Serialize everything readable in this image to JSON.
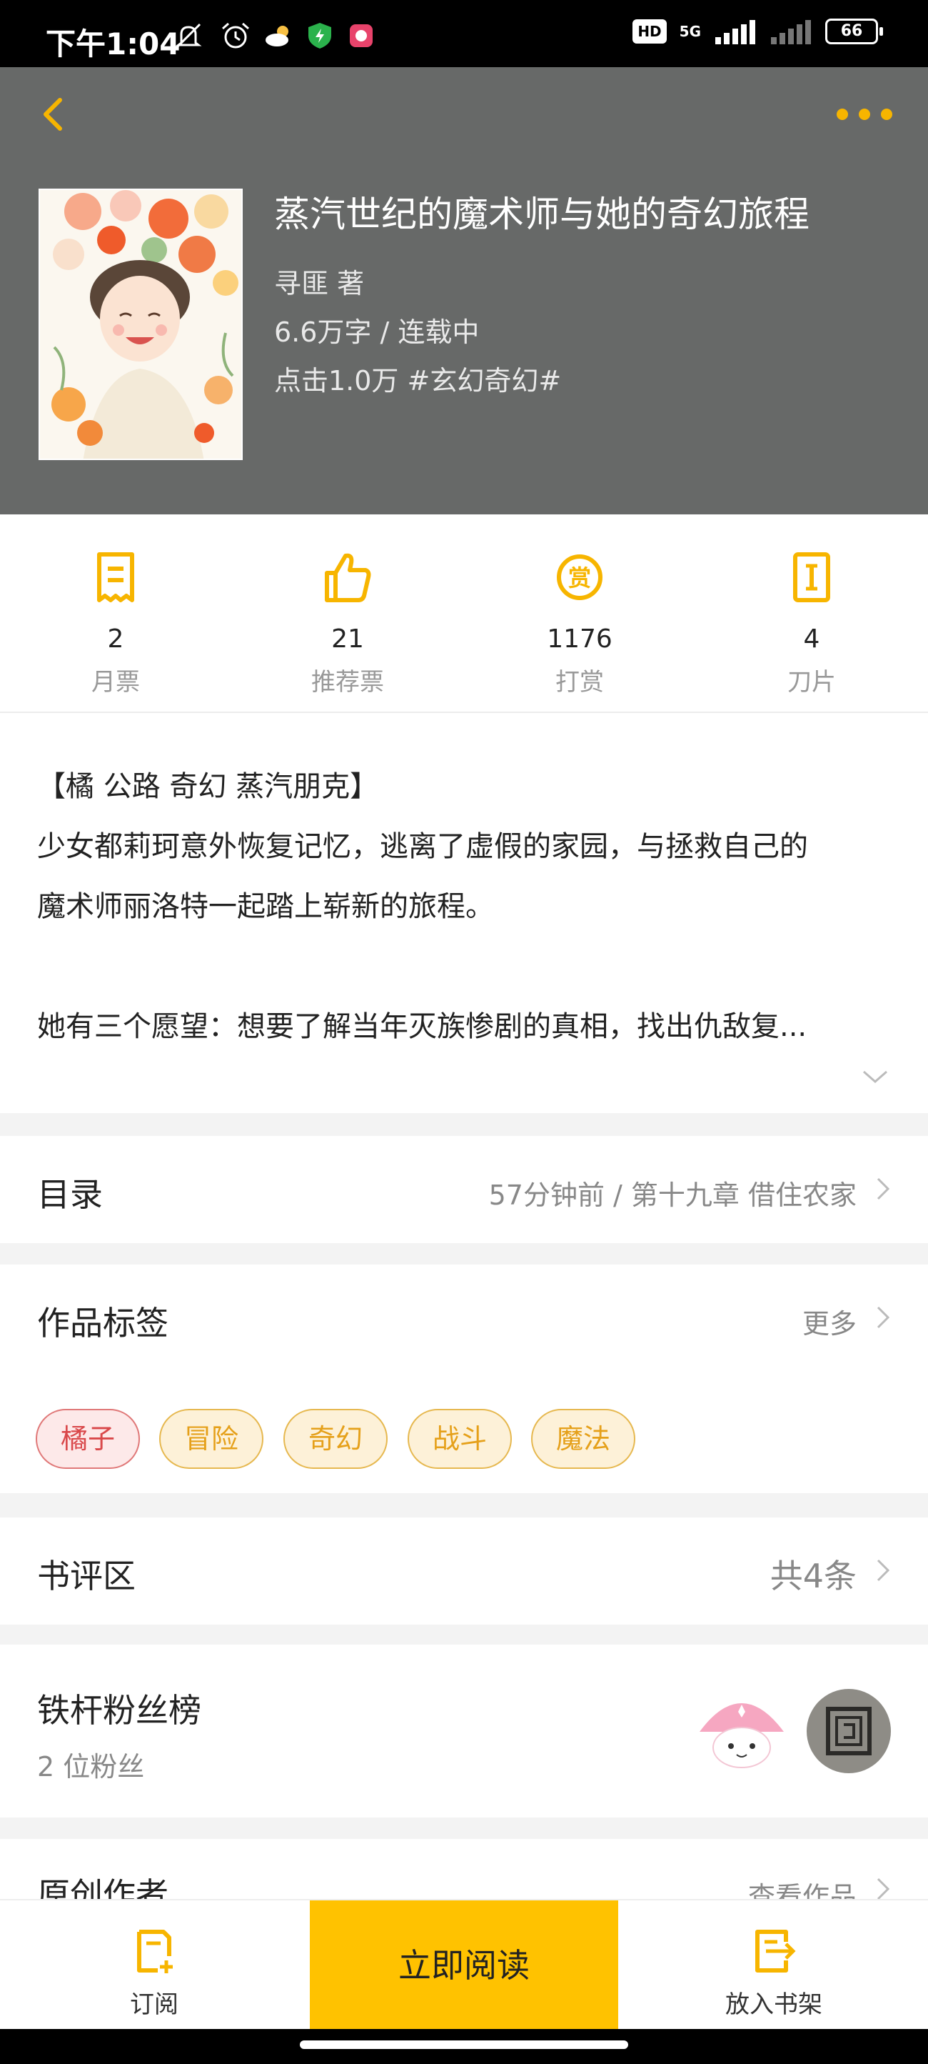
{
  "status_bar": {
    "time": "下午1:04",
    "hd": "HD",
    "network": "5G",
    "battery": "66"
  },
  "book": {
    "title": "蒸汽世纪的魔术师与她的奇幻旅程",
    "author": "寻匪  著",
    "words_status": "6.6万字 / 连载中",
    "clicks_genre": "点击1.0万  #玄幻奇幻#"
  },
  "stats": [
    {
      "value": "2",
      "label": "月票",
      "icon": "ticket-icon"
    },
    {
      "value": "21",
      "label": "推荐票",
      "icon": "thumbs-up-icon"
    },
    {
      "value": "1176",
      "label": "打赏",
      "icon": "reward-coin-icon"
    },
    {
      "value": "4",
      "label": "刀片",
      "icon": "blade-card-icon"
    }
  ],
  "intro": {
    "line1": "【橘 公路 奇幻 蒸汽朋克】",
    "line2": "少女都莉珂意外恢复记忆，逃离了虚假的家园，与拯救自己的",
    "line3": "魔术师丽洛特一起踏上崭新的旅程。",
    "line4": "她有三个愿望：想要了解当年灭族惨剧的真相，找出仇敌复..."
  },
  "toc": {
    "title": "目录",
    "latest": "57分钟前 / 第十九章 借住农家"
  },
  "tags": {
    "title": "作品标签",
    "more": "更多",
    "items": [
      "橘子",
      "冒险",
      "奇幻",
      "战斗",
      "魔法"
    ]
  },
  "reviews": {
    "title": "书评区",
    "count": "共4条"
  },
  "fans": {
    "title": "铁杆粉丝榜",
    "count": "2 位粉丝"
  },
  "author_section": {
    "title": "原创作者",
    "link": "查看作品"
  },
  "bottom_bar": {
    "subscribe": "订阅",
    "read_now": "立即阅读",
    "add_shelf": "放入书架"
  },
  "colors": {
    "accent": "#f7b500",
    "hero_bg": "#676968",
    "read_button": "#ffc200"
  }
}
